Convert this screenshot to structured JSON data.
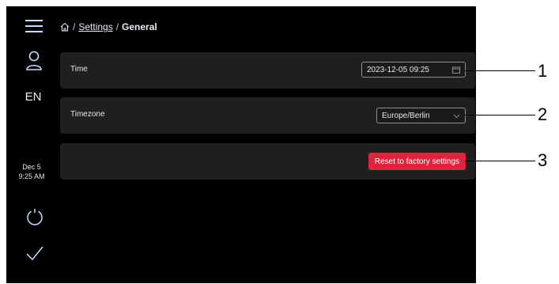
{
  "sidebar": {
    "language": "EN",
    "date": "Dec 5",
    "time": "9:25 AM"
  },
  "breadcrumb": {
    "link": "Settings",
    "separator": "/",
    "current": "General"
  },
  "rows": {
    "time": {
      "label": "Time",
      "value": "2023-12-05 09:25"
    },
    "timezone": {
      "label": "Timezone",
      "value": "Europe/Berlin"
    },
    "reset": {
      "button_label": "Reset to factory settings"
    }
  },
  "callouts": [
    "1",
    "2",
    "3"
  ],
  "colors": {
    "accent_red": "#e0243d",
    "background": "#000000",
    "row_background": "#1f1f1f"
  }
}
